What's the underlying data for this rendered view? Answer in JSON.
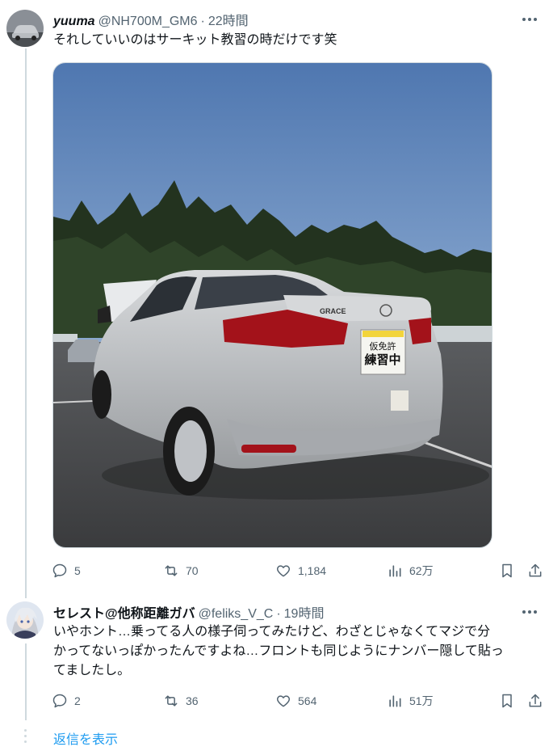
{
  "tweets": [
    {
      "name": "yuuma",
      "handle": "@NH700M_GM6",
      "separator": "·",
      "time": "22時間",
      "text": "それしていいのはサーキット教習の時だけです笑",
      "photo": {
        "rear_emblem": "GRACE",
        "plate_sign_top": "仮免許",
        "plate_sign_main": "練習中"
      },
      "stats": {
        "replies": "5",
        "retweets": "70",
        "likes": "1,184",
        "views": "62万"
      }
    },
    {
      "name": "セレスト@他称距離ガバ",
      "handle": "@feliks_V_C",
      "separator": "·",
      "time": "19時間",
      "text_lines": [
        "いやホント…乗ってる人の様子伺ってみたけど、わざとじゃなくてマジで分",
        "かってないっぽかったんですよね…フロントも同じようにナンバー隠して貼っ",
        "てましたし。"
      ],
      "stats": {
        "replies": "2",
        "retweets": "36",
        "likes": "564",
        "views": "51万"
      }
    }
  ],
  "show_replies_label": "返信を表示",
  "colors": {
    "text": "#0f1419",
    "muted": "#536471",
    "link": "#1d9bf0",
    "line": "#cfd9de"
  },
  "icons": [
    "reply-icon",
    "retweet-icon",
    "like-icon",
    "views-icon",
    "bookmark-icon",
    "share-icon",
    "more-icon"
  ]
}
